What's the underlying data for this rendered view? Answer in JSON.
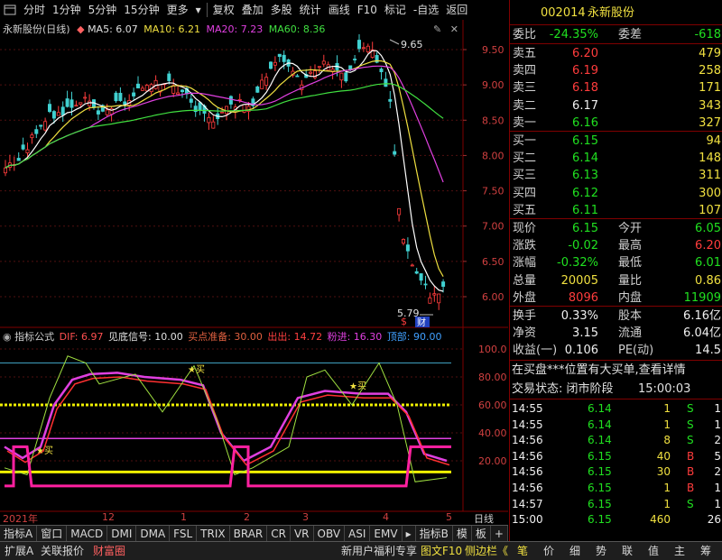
{
  "toolbar": {
    "items": [
      "分时",
      "1分钟",
      "5分钟",
      "15分钟",
      "更多",
      "复权",
      "叠加",
      "多股",
      "统计",
      "画线",
      "F10",
      "标记",
      "-自选",
      "返回"
    ]
  },
  "main_chart": {
    "stock_label": "永新股份(日线)",
    "ma5_label": "MA5: 6.07",
    "ma10_label": "MA10: 6.21",
    "ma20_label": "MA20: 7.23",
    "ma60_label": "MA60: 8.36",
    "high_label": "9.65",
    "low_label": "5.79",
    "y_ticks": [
      "9.50",
      "9.00",
      "8.50",
      "8.00",
      "7.50",
      "7.00",
      "6.50",
      "6.00"
    ],
    "markers": [
      "$",
      "财"
    ]
  },
  "indicator": {
    "title": "指标公式",
    "dif": "DIF: 6.97",
    "jiandi": "见底信号: 10.00",
    "maidian": "买点准备: 30.00",
    "chuchu": "出出: 14.72",
    "fenjin": "粉进: 16.30",
    "dingbu": "顶部: 90.00",
    "y_ticks": [
      "100.0",
      "80.00",
      "60.00",
      "40.00",
      "20.00"
    ],
    "buy_label": "买"
  },
  "xaxis": {
    "labels": [
      "2021年",
      "12",
      "1",
      "2",
      "3",
      "4",
      "5"
    ],
    "period": "日线"
  },
  "tabs": [
    "指标A",
    "窗口",
    "MACD",
    "DMI",
    "DMA",
    "FSL",
    "TRIX",
    "BRAR",
    "CR",
    "VR",
    "OBV",
    "ASI",
    "EMV",
    "指标B",
    "模",
    "板",
    "+",
    "−"
  ],
  "bottom": {
    "items": [
      "扩展A",
      "关联报价",
      "财富圈"
    ],
    "right_items": [
      "新用户福利专享",
      "图文F10",
      "侧边栏《"
    ],
    "buttons": [
      "笔",
      "价",
      "细",
      "势",
      "联",
      "值",
      "主",
      "筹"
    ]
  },
  "quote": {
    "code": "002014",
    "name": "永新股份",
    "weibi_label": "委比",
    "weibi": "-24.35%",
    "weicha_label": "委差",
    "weicha": "-618",
    "asks": [
      {
        "label": "卖五",
        "price": "6.20",
        "vol": "479"
      },
      {
        "label": "卖四",
        "price": "6.19",
        "vol": "258"
      },
      {
        "label": "卖三",
        "price": "6.18",
        "vol": "171"
      },
      {
        "label": "卖二",
        "price": "6.17",
        "vol": "343"
      },
      {
        "label": "卖一",
        "price": "6.16",
        "vol": "327"
      }
    ],
    "bids": [
      {
        "label": "买一",
        "price": "6.15",
        "vol": "94"
      },
      {
        "label": "买二",
        "price": "6.14",
        "vol": "148"
      },
      {
        "label": "买三",
        "price": "6.13",
        "vol": "311"
      },
      {
        "label": "买四",
        "price": "6.12",
        "vol": "300"
      },
      {
        "label": "买五",
        "price": "6.11",
        "vol": "107"
      }
    ],
    "stats": [
      {
        "l1": "现价",
        "v1": "6.15",
        "l2": "今开",
        "v2": "6.05"
      },
      {
        "l1": "涨跌",
        "v1": "-0.02",
        "l2": "最高",
        "v2": "6.20"
      },
      {
        "l1": "涨幅",
        "v1": "-0.32%",
        "l2": "最低",
        "v2": "6.01"
      },
      {
        "l1": "总量",
        "v1": "20005",
        "l2": "量比",
        "v2": "0.86"
      },
      {
        "l1": "外盘",
        "v1": "8096",
        "l2": "内盘",
        "v2": "11909"
      }
    ],
    "stats2": [
      {
        "l1": "换手",
        "v1": "0.33%",
        "l2": "股本",
        "v2": "6.16亿"
      },
      {
        "l1": "净资",
        "v1": "3.15",
        "l2": "流通",
        "v2": "6.04亿"
      },
      {
        "l1": "收益(一)",
        "v1": "0.106",
        "l2": "PE(动)",
        "v2": "14.5"
      }
    ],
    "notice": "在买盘***位置有大买单,查看详情",
    "status_label": "交易状态: 闭市阶段",
    "status_time": "15:00:03",
    "ticks": [
      {
        "t": "14:55",
        "p": "6.14",
        "v": "1",
        "d": "S",
        "n": "1"
      },
      {
        "t": "14:55",
        "p": "6.14",
        "v": "1",
        "d": "S",
        "n": "1"
      },
      {
        "t": "14:56",
        "p": "6.14",
        "v": "8",
        "d": "S",
        "n": "2"
      },
      {
        "t": "14:56",
        "p": "6.15",
        "v": "40",
        "d": "B",
        "n": "5"
      },
      {
        "t": "14:56",
        "p": "6.15",
        "v": "30",
        "d": "B",
        "n": "2"
      },
      {
        "t": "14:56",
        "p": "6.15",
        "v": "1",
        "d": "B",
        "n": "1"
      },
      {
        "t": "14:57",
        "p": "6.15",
        "v": "1",
        "d": "S",
        "n": "1"
      },
      {
        "t": "15:00",
        "p": "6.15",
        "v": "460",
        "d": "",
        "n": "26"
      }
    ]
  },
  "colors": {
    "up": "#ff3c3c",
    "down": "#20e020",
    "ma5": "#ffffff",
    "ma10": "#f0e040",
    "ma20": "#e040e0",
    "ma60": "#40e040"
  }
}
